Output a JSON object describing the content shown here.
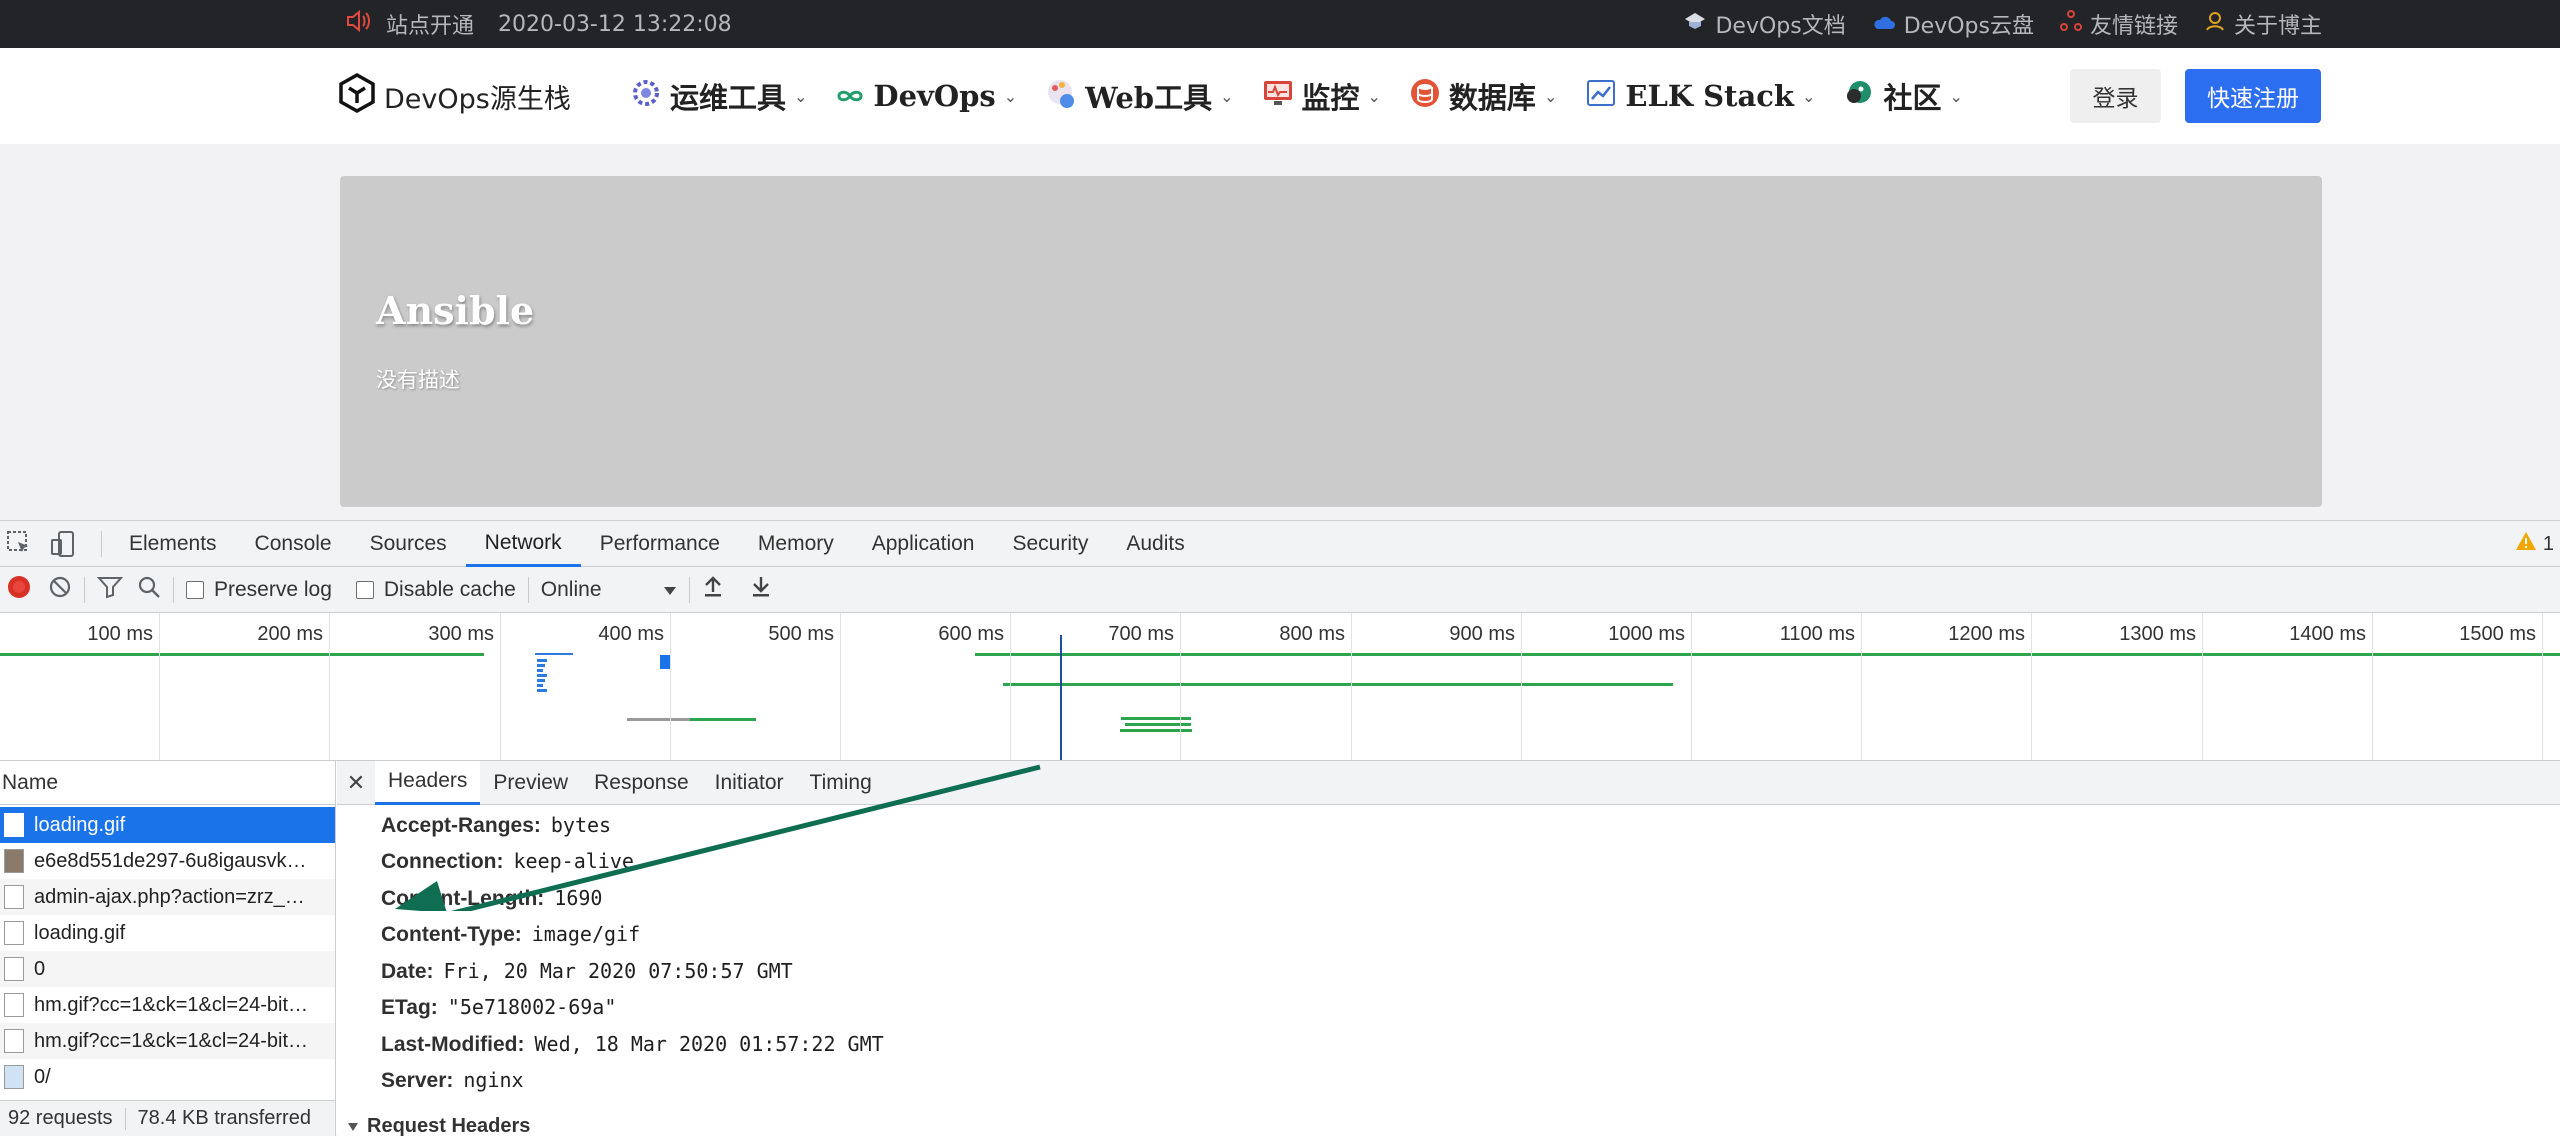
{
  "topbar": {
    "notice": "站点开通",
    "date": "2020-03-12 13:22:08",
    "links": [
      "DevOps文档",
      "DevOps云盘",
      "友情链接",
      "关于博主"
    ]
  },
  "header": {
    "logo_text": "DevOps源生栈",
    "nav": [
      "运维工具",
      "DevOps",
      "Web工具",
      "监控",
      "数据库",
      "ELK Stack",
      "社区"
    ],
    "login": "登录",
    "register": "快速注册"
  },
  "hero": {
    "title": "Ansible",
    "description": "没有描述"
  },
  "devtools": {
    "tabs": [
      "Elements",
      "Console",
      "Sources",
      "Network",
      "Performance",
      "Memory",
      "Application",
      "Security",
      "Audits"
    ],
    "active_tab": "Network",
    "warning_count": "1",
    "toolbar": {
      "preserve_log": "Preserve log",
      "disable_cache": "Disable cache",
      "throttle": "Online"
    },
    "timeline_ticks": [
      "100 ms",
      "200 ms",
      "300 ms",
      "400 ms",
      "500 ms",
      "600 ms",
      "700 ms",
      "800 ms",
      "900 ms",
      "1000 ms",
      "1100 ms",
      "1200 ms",
      "1300 ms",
      "1400 ms",
      "1500 ms"
    ],
    "request_list": {
      "header": "Name",
      "rows": [
        "loading.gif",
        "e6e8d551de297-6u8igausvk…",
        "admin-ajax.php?action=zrz_…",
        "loading.gif",
        "0",
        "hm.gif?cc=1&ck=1&cl=24-bit…",
        "hm.gif?cc=1&ck=1&cl=24-bit…",
        "0/"
      ],
      "status_requests": "92 requests",
      "status_transferred": "78.4 KB transferred"
    },
    "detail": {
      "tabs": [
        "Headers",
        "Preview",
        "Response",
        "Initiator",
        "Timing"
      ],
      "active_tab": "Headers",
      "headers": [
        {
          "key": "Accept-Ranges:",
          "value": "bytes"
        },
        {
          "key": "Connection:",
          "value": "keep-alive"
        },
        {
          "key": "Content-Length:",
          "value": "1690"
        },
        {
          "key": "Content-Type:",
          "value": "image/gif"
        },
        {
          "key": "Date:",
          "value": "Fri, 20 Mar 2020 07:50:57 GMT"
        },
        {
          "key": "ETag:",
          "value": "\"5e718002-69a\""
        },
        {
          "key": "Last-Modified:",
          "value": "Wed, 18 Mar 2020 01:57:22 GMT"
        },
        {
          "key": "Server:",
          "value": "nginx"
        }
      ],
      "request_headers": "Request Headers"
    }
  },
  "colors": {
    "accent": "#1a73e8",
    "register": "#2c6ef0",
    "arrow": "#0f6e52",
    "timeline_green": "#2da44e"
  }
}
